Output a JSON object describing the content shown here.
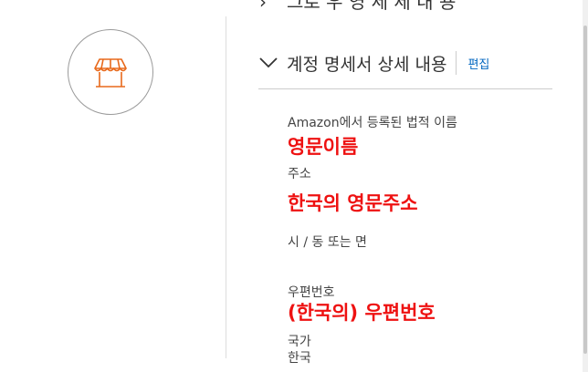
{
  "top_section": {
    "title": "그로 우 영 세 세 내 용"
  },
  "section": {
    "title": "계정 명세서 상세 내용",
    "edit_label": "편집"
  },
  "fields": [
    {
      "label": "Amazon에서 등록된 법적 이름",
      "value": "영문이름"
    },
    {
      "label": "주소",
      "value": "한국의 영문주소"
    },
    {
      "label": "시 / 동 또는 면",
      "value": ""
    },
    {
      "label": "우편번호",
      "value": "(한국의) 우편번호"
    },
    {
      "label": "국가",
      "value": "한국"
    }
  ],
  "icons": {
    "store": "store-icon",
    "expand": "chevron-down-icon"
  },
  "colors": {
    "accent": "#0066c0",
    "annotation": "#ee1111",
    "icon": "#e8691b",
    "border": "#cccccc"
  }
}
